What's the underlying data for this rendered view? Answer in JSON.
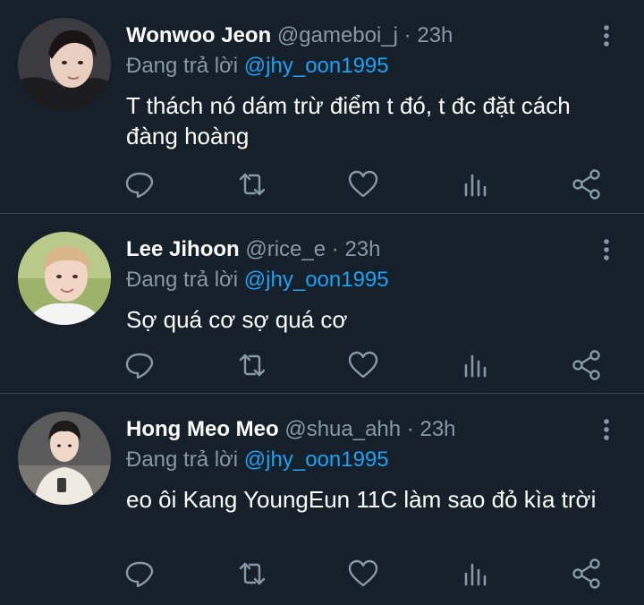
{
  "reply_prefix": "Đang trả lời",
  "colors": {
    "background": "#15202b",
    "divider": "#38444d",
    "secondary_text": "#8899a6",
    "mention": "#1da1f2",
    "icon": "#8899a6"
  },
  "tweets": [
    {
      "name": "Wonwoo Jeon",
      "handle": "@gameboi_j",
      "separator": "·",
      "time": "23h",
      "reply_to": "@jhy_oon1995",
      "text": "T thách nó dám trừ điểm t đó, t đc đặt cách đàng hoàng"
    },
    {
      "name": "Lee Jihoon",
      "handle": "@rice_e",
      "separator": "·",
      "time": "23h",
      "reply_to": "@jhy_oon1995",
      "text": "Sợ quá cơ sợ quá cơ"
    },
    {
      "name": "Hong Meo Meo",
      "handle": "@shua_ahh",
      "separator": "·",
      "time": "23h",
      "reply_to": "@jhy_oon1995",
      "text": "eo ôi Kang YoungEun 11C làm sao đỏ kìa trời"
    }
  ],
  "action_icons": [
    "reply-icon",
    "retweet-icon",
    "like-icon",
    "analytics-icon",
    "share-icon"
  ]
}
